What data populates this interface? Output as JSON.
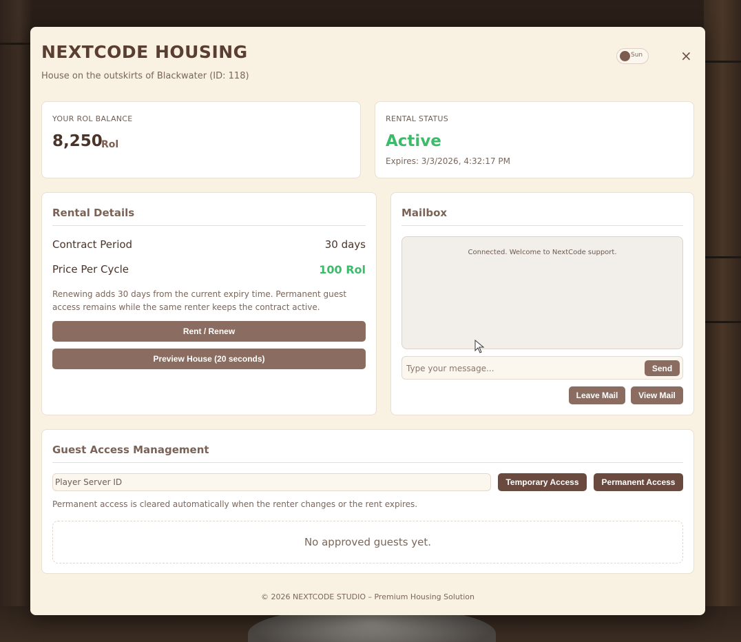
{
  "header": {
    "title": "NEXTCODE HOUSING",
    "subtitle": "House on the outskirts of Blackwater (ID: 118)",
    "theme_toggle_label": "Sun",
    "close_label": "×"
  },
  "balance": {
    "label": "YOUR ROL BALANCE",
    "value": "8,250",
    "unit": "Rol"
  },
  "rental_status": {
    "label": "RENTAL STATUS",
    "value": "Active",
    "expires": "Expires: 3/3/2026, 4:32:17 PM"
  },
  "rental_details": {
    "title": "Rental Details",
    "contract_label": "Contract Period",
    "contract_value": "30 days",
    "price_label": "Price Per Cycle",
    "price_value": "100 Rol",
    "note": "Renewing adds 30 days from the current expiry time. Permanent guest access remains while the same renter keeps the contract active.",
    "rent_button": "Rent / Renew",
    "preview_button": "Preview House (20 seconds)"
  },
  "mailbox": {
    "title": "Mailbox",
    "messages": [
      "Connected. Welcome to NextCode support."
    ],
    "input_placeholder": "Type your message...",
    "send_button": "Send",
    "leave_button": "Leave Mail",
    "view_button": "View Mail"
  },
  "guest_access": {
    "title": "Guest Access Management",
    "input_placeholder": "Player Server ID",
    "temporary_button": "Temporary Access",
    "permanent_button": "Permanent Access",
    "note": "Permanent access is cleared automatically when the renter changes or the rent expires.",
    "empty_text": "No approved guests yet."
  },
  "footer": {
    "text": "© 2026 NEXTCODE STUDIO – Premium Housing Solution"
  },
  "colors": {
    "panel_bg": "#f9f1e1",
    "accent_brown": "#8a6d60",
    "dark_brown": "#6a4a3e",
    "status_green": "#3dba6a"
  }
}
